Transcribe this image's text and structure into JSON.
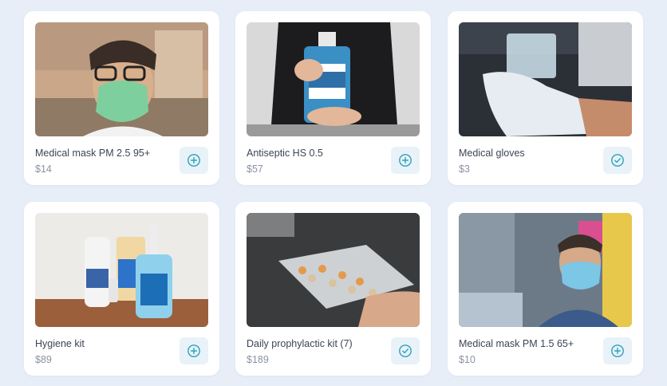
{
  "products": [
    {
      "name": "Medical mask PM 2.5 95+",
      "price": "$14",
      "action_icon": "plus-circle-icon",
      "image": "man-in-green-mask-photo"
    },
    {
      "name": "Antiseptic HS 0.5",
      "price": "$57",
      "action_icon": "plus-circle-icon",
      "image": "hand-sanitizer-bottle-photo"
    },
    {
      "name": "Medical gloves",
      "price": "$3",
      "action_icon": "check-circle-icon",
      "image": "gloved-hands-lab-photo"
    },
    {
      "name": "Hygiene kit",
      "price": "$89",
      "action_icon": "plus-circle-icon",
      "image": "cleaning-products-photo"
    },
    {
      "name": "Daily prophylactic kit (7)",
      "price": "$189",
      "action_icon": "check-circle-icon",
      "image": "pill-organizer-photo"
    },
    {
      "name": "Medical mask PM 1.5 65+",
      "price": "$10",
      "action_icon": "plus-circle-icon",
      "image": "man-in-blue-mask-street-photo"
    }
  ],
  "colors": {
    "accent": "#2ba3b8",
    "button_bg": "#e9f2f8",
    "page_bg": "#e7eef8"
  }
}
